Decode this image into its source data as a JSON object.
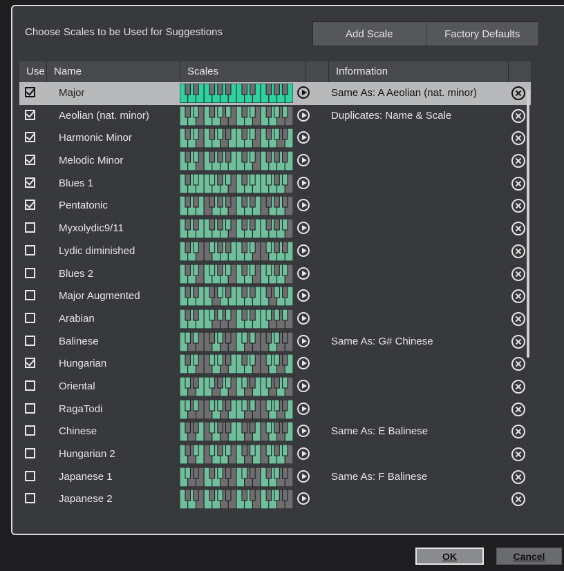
{
  "dialog": {
    "title": "Choose Scales to be Used for Suggestions",
    "add_scale_label": "Add Scale",
    "factory_defaults_label": "Factory Defaults",
    "ok_label": "OK",
    "cancel_label": "Cancel"
  },
  "columns": {
    "use": "Use",
    "name": "Name",
    "scales": "Scales",
    "information": "Information"
  },
  "colors": {
    "active_key": "#6fbf9d",
    "active_key_selected": "#2fd1a0",
    "inactive_key": "#6e6e70"
  },
  "rows": [
    {
      "name": "Major",
      "checked": true,
      "selected": true,
      "info": "Same As:  A Aeolian (nat. minor)",
      "notes": [
        1,
        0,
        1,
        0,
        1,
        1,
        0,
        1,
        0,
        1,
        0,
        1
      ]
    },
    {
      "name": "Aeolian (nat. minor)",
      "checked": true,
      "selected": false,
      "info": "Duplicates: Name & Scale",
      "notes": [
        1,
        0,
        1,
        1,
        0,
        1,
        0,
        1,
        1,
        0,
        1,
        0
      ]
    },
    {
      "name": "Harmonic Minor",
      "checked": true,
      "selected": false,
      "info": "",
      "notes": [
        1,
        0,
        1,
        1,
        0,
        1,
        0,
        1,
        1,
        0,
        0,
        1
      ]
    },
    {
      "name": "Melodic Minor",
      "checked": true,
      "selected": false,
      "info": "",
      "notes": [
        1,
        0,
        1,
        1,
        0,
        1,
        0,
        1,
        0,
        1,
        0,
        1
      ]
    },
    {
      "name": "Blues 1",
      "checked": true,
      "selected": false,
      "info": "",
      "notes": [
        1,
        0,
        1,
        1,
        1,
        1,
        1,
        1,
        0,
        1,
        1,
        0
      ]
    },
    {
      "name": "Pentatonic",
      "checked": true,
      "selected": false,
      "info": "",
      "notes": [
        1,
        0,
        1,
        0,
        1,
        0,
        0,
        1,
        0,
        1,
        0,
        0
      ]
    },
    {
      "name": "Myxolydic9/11",
      "checked": false,
      "selected": false,
      "info": "",
      "notes": [
        1,
        0,
        1,
        0,
        1,
        1,
        0,
        1,
        0,
        1,
        1,
        0
      ]
    },
    {
      "name": "Lydic diminished",
      "checked": false,
      "selected": false,
      "info": "",
      "notes": [
        1,
        0,
        1,
        1,
        0,
        0,
        1,
        1,
        0,
        1,
        0,
        1
      ]
    },
    {
      "name": "Blues 2",
      "checked": false,
      "selected": false,
      "info": "",
      "notes": [
        1,
        0,
        1,
        1,
        0,
        1,
        1,
        1,
        0,
        1,
        1,
        0
      ]
    },
    {
      "name": "Major Augmented",
      "checked": false,
      "selected": false,
      "info": "",
      "notes": [
        1,
        0,
        1,
        0,
        1,
        1,
        0,
        0,
        1,
        1,
        0,
        1
      ]
    },
    {
      "name": "Arabian",
      "checked": false,
      "selected": false,
      "info": "",
      "notes": [
        1,
        0,
        1,
        0,
        1,
        1,
        1,
        0,
        1,
        0,
        1,
        0
      ]
    },
    {
      "name": "Balinese",
      "checked": false,
      "selected": false,
      "info": "Same As:  G# Chinese",
      "notes": [
        1,
        1,
        0,
        1,
        0,
        0,
        0,
        1,
        1,
        0,
        0,
        0
      ]
    },
    {
      "name": "Hungarian",
      "checked": true,
      "selected": false,
      "info": "",
      "notes": [
        1,
        0,
        1,
        1,
        0,
        0,
        1,
        1,
        1,
        0,
        0,
        1
      ]
    },
    {
      "name": "Oriental",
      "checked": false,
      "selected": false,
      "info": "",
      "notes": [
        1,
        1,
        0,
        0,
        1,
        1,
        1,
        0,
        0,
        1,
        1,
        0
      ]
    },
    {
      "name": "RagaTodi",
      "checked": false,
      "selected": false,
      "info": "",
      "notes": [
        1,
        1,
        0,
        1,
        0,
        0,
        1,
        1,
        1,
        0,
        0,
        1
      ]
    },
    {
      "name": "Chinese",
      "checked": false,
      "selected": false,
      "info": "Same As:  E Balinese",
      "notes": [
        1,
        0,
        0,
        0,
        1,
        0,
        1,
        1,
        0,
        0,
        0,
        1
      ]
    },
    {
      "name": "Hungarian 2",
      "checked": false,
      "selected": false,
      "info": "",
      "notes": [
        1,
        0,
        0,
        1,
        1,
        0,
        1,
        1,
        0,
        1,
        1,
        0
      ]
    },
    {
      "name": "Japanese 1",
      "checked": false,
      "selected": false,
      "info": "Same As:  F Balinese",
      "notes": [
        1,
        1,
        0,
        0,
        0,
        1,
        0,
        1,
        1,
        0,
        0,
        0
      ]
    },
    {
      "name": "Japanese 2",
      "checked": false,
      "selected": false,
      "info": "",
      "notes": [
        1,
        0,
        1,
        0,
        0,
        1,
        0,
        1,
        1,
        0,
        0,
        0
      ]
    }
  ]
}
